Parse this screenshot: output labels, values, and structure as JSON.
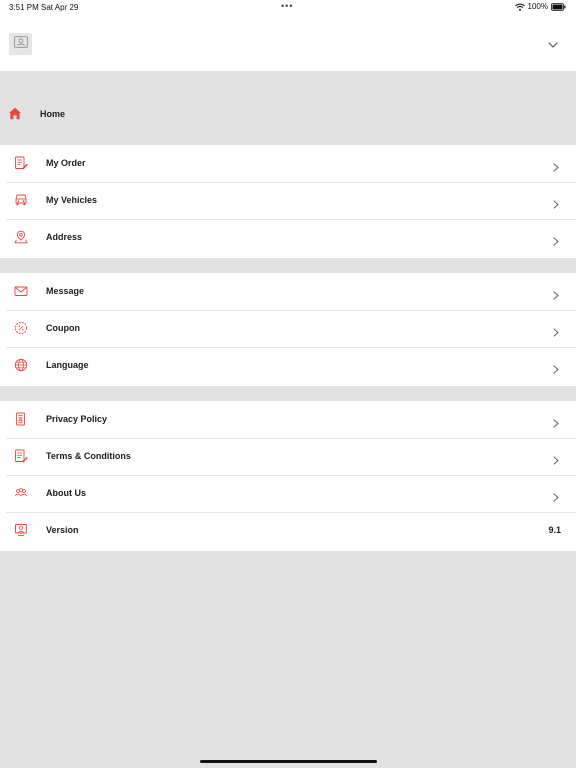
{
  "status_bar": {
    "time": "3:51 PM",
    "date": "Sat Apr 29",
    "dots": "•••",
    "battery_percent": "100%",
    "icons": [
      "wifi-icon",
      "battery-icon"
    ]
  },
  "header": {
    "avatar_icon": "profile-card-icon",
    "collapse_icon": "chevron-down-icon"
  },
  "home": {
    "label": "Home",
    "icon": "home-icon"
  },
  "menu": {
    "group_1": [
      {
        "label": "My Order",
        "icon": "order-icon"
      },
      {
        "label": "My Vehicles",
        "icon": "vehicle-icon"
      },
      {
        "label": "Address",
        "icon": "address-pin-icon"
      }
    ],
    "group_2": [
      {
        "label": "Message",
        "icon": "envelope-icon"
      },
      {
        "label": "Coupon",
        "icon": "coupon-icon"
      },
      {
        "label": "Language",
        "icon": "globe-icon"
      }
    ],
    "group_3": [
      {
        "label": "Privacy Policy",
        "icon": "privacy-document-icon"
      },
      {
        "label": "Terms & Conditions",
        "icon": "terms-document-icon"
      },
      {
        "label": "About Us",
        "icon": "about-us-icon"
      },
      {
        "label": "Version",
        "icon": "version-icon",
        "value": "9.1"
      }
    ]
  },
  "colors": {
    "accent": "#e8473c",
    "background": "#e2e2e2",
    "surface": "#ffffff",
    "divider": "#e6e6e6"
  }
}
